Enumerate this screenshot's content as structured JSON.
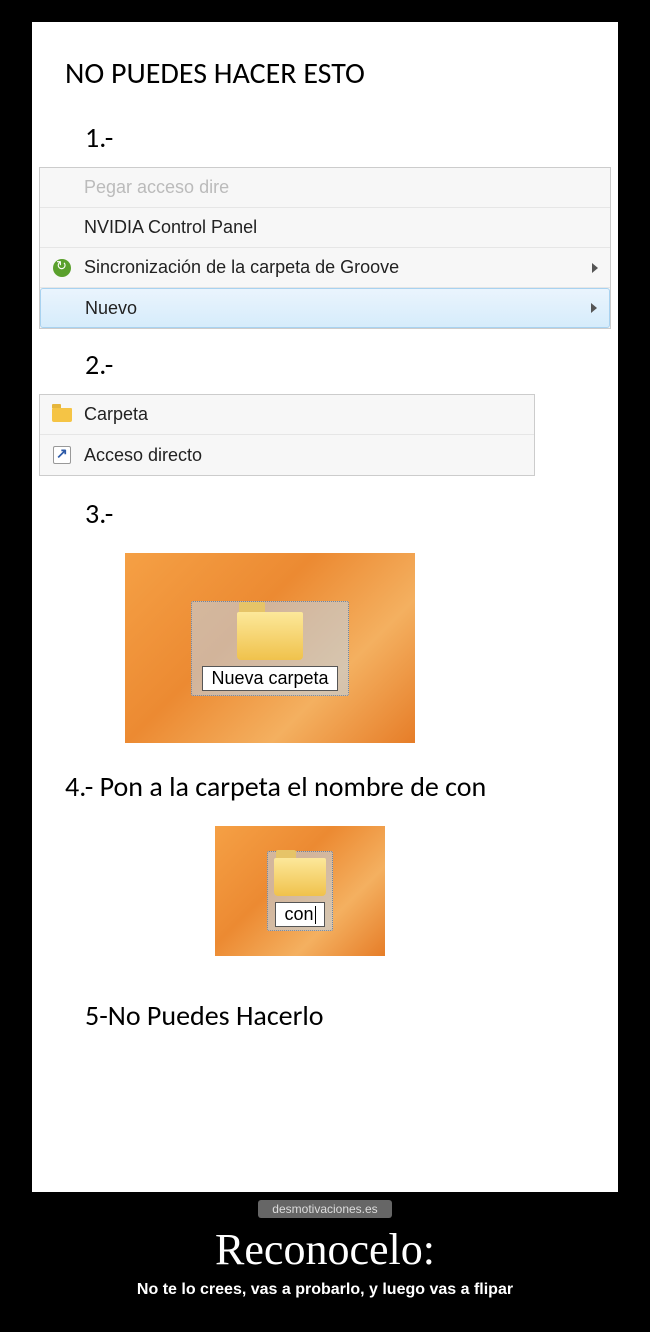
{
  "heading": "NO PUEDES HACER ESTO",
  "steps": {
    "s1": "1.-",
    "s2": "2.-",
    "s3": "3.-",
    "s4": "4.- Pon a la carpeta el nombre de con",
    "s5": "5-No Puedes Hacerlo"
  },
  "menu1": {
    "row0": "Pegar acceso dire",
    "row1": "NVIDIA Control Panel",
    "row2": "Sincronización de la carpeta de Groove",
    "row3": "Nuevo"
  },
  "menu2": {
    "row0": "Carpeta",
    "row1": "Acceso directo"
  },
  "folder1_label": "Nueva carpeta",
  "folder2_label": "con",
  "watermark": "desmotivaciones.es",
  "caption_title": "Reconocelo:",
  "caption_sub": "No te lo crees, vas a probarlo, y luego vas a flipar"
}
